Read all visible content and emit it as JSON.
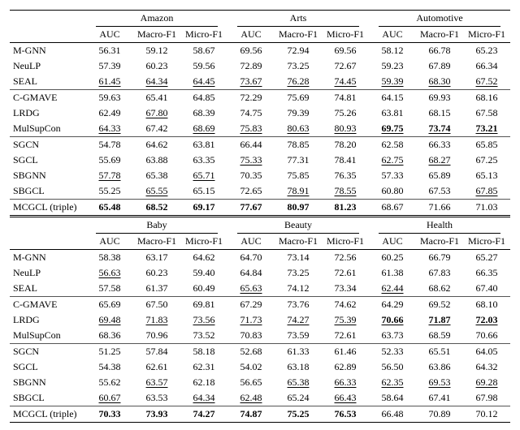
{
  "metrics": [
    "AUC",
    "Macro-F1",
    "Micro-F1"
  ],
  "groups": [
    [
      "M-GNN",
      "NeuLP",
      "SEAL"
    ],
    [
      "C-GMAVE",
      "LRDG",
      "MulSupCon"
    ],
    [
      "SGCN",
      "SGCL",
      "SBGNN",
      "SBGCL"
    ],
    [
      "MCGCL (triple)"
    ]
  ],
  "blocks": [
    {
      "datasets": [
        "Amazon",
        "Arts",
        "Automotive"
      ],
      "rows": {
        "M-GNN": [
          [
            "56.31",
            "p"
          ],
          [
            "59.12",
            "p"
          ],
          [
            "58.67",
            "p"
          ],
          [
            "69.56",
            "p"
          ],
          [
            "72.94",
            "p"
          ],
          [
            "69.56",
            "p"
          ],
          [
            "58.12",
            "p"
          ],
          [
            "66.78",
            "p"
          ],
          [
            "65.23",
            "p"
          ]
        ],
        "NeuLP": [
          [
            "57.39",
            "p"
          ],
          [
            "60.23",
            "p"
          ],
          [
            "59.56",
            "p"
          ],
          [
            "72.89",
            "p"
          ],
          [
            "73.25",
            "p"
          ],
          [
            "72.67",
            "p"
          ],
          [
            "59.23",
            "p"
          ],
          [
            "67.89",
            "p"
          ],
          [
            "66.34",
            "p"
          ]
        ],
        "SEAL": [
          [
            "61.45",
            "u"
          ],
          [
            "64.34",
            "u"
          ],
          [
            "64.45",
            "u"
          ],
          [
            "73.67",
            "u"
          ],
          [
            "76.28",
            "u"
          ],
          [
            "74.45",
            "u"
          ],
          [
            "59.39",
            "u"
          ],
          [
            "68.30",
            "u"
          ],
          [
            "67.52",
            "u"
          ]
        ],
        "C-GMAVE": [
          [
            "59.63",
            "p"
          ],
          [
            "65.41",
            "p"
          ],
          [
            "64.85",
            "p"
          ],
          [
            "72.29",
            "p"
          ],
          [
            "75.69",
            "p"
          ],
          [
            "74.81",
            "p"
          ],
          [
            "64.15",
            "p"
          ],
          [
            "69.93",
            "p"
          ],
          [
            "68.16",
            "p"
          ]
        ],
        "LRDG": [
          [
            "62.49",
            "p"
          ],
          [
            "67.80",
            "u"
          ],
          [
            "68.39",
            "p"
          ],
          [
            "74.75",
            "p"
          ],
          [
            "79.39",
            "p"
          ],
          [
            "75.26",
            "p"
          ],
          [
            "63.81",
            "p"
          ],
          [
            "68.15",
            "p"
          ],
          [
            "67.58",
            "p"
          ]
        ],
        "MulSupCon": [
          [
            "64.33",
            "u"
          ],
          [
            "67.42",
            "p"
          ],
          [
            "68.69",
            "u"
          ],
          [
            "75.83",
            "u"
          ],
          [
            "80.63",
            "u"
          ],
          [
            "80.93",
            "u"
          ],
          [
            "69.75",
            "bu"
          ],
          [
            "73.74",
            "bu"
          ],
          [
            "73.21",
            "bu"
          ]
        ],
        "SGCN": [
          [
            "54.78",
            "p"
          ],
          [
            "64.62",
            "p"
          ],
          [
            "63.81",
            "p"
          ],
          [
            "66.44",
            "p"
          ],
          [
            "78.85",
            "p"
          ],
          [
            "78.20",
            "p"
          ],
          [
            "62.58",
            "p"
          ],
          [
            "66.33",
            "p"
          ],
          [
            "65.85",
            "p"
          ]
        ],
        "SGCL": [
          [
            "55.69",
            "p"
          ],
          [
            "63.88",
            "p"
          ],
          [
            "63.35",
            "p"
          ],
          [
            "75.33",
            "u"
          ],
          [
            "77.31",
            "p"
          ],
          [
            "78.41",
            "p"
          ],
          [
            "62.75",
            "u"
          ],
          [
            "68.27",
            "u"
          ],
          [
            "67.25",
            "p"
          ]
        ],
        "SBGNN": [
          [
            "57.78",
            "u"
          ],
          [
            "65.38",
            "p"
          ],
          [
            "65.71",
            "u"
          ],
          [
            "70.35",
            "p"
          ],
          [
            "75.85",
            "p"
          ],
          [
            "76.35",
            "p"
          ],
          [
            "57.33",
            "p"
          ],
          [
            "65.89",
            "p"
          ],
          [
            "65.13",
            "p"
          ]
        ],
        "SBGCL": [
          [
            "55.25",
            "p"
          ],
          [
            "65.55",
            "u"
          ],
          [
            "65.15",
            "p"
          ],
          [
            "72.65",
            "p"
          ],
          [
            "78.91",
            "u"
          ],
          [
            "78.55",
            "u"
          ],
          [
            "60.80",
            "p"
          ],
          [
            "67.53",
            "p"
          ],
          [
            "67.85",
            "u"
          ]
        ],
        "MCGCL (triple)": [
          [
            "65.48",
            "b"
          ],
          [
            "68.52",
            "b"
          ],
          [
            "69.17",
            "b"
          ],
          [
            "77.67",
            "b"
          ],
          [
            "80.97",
            "b"
          ],
          [
            "81.23",
            "b"
          ],
          [
            "68.67",
            "p"
          ],
          [
            "71.66",
            "p"
          ],
          [
            "71.03",
            "p"
          ]
        ]
      }
    },
    {
      "datasets": [
        "Baby",
        "Beauty",
        "Health"
      ],
      "rows": {
        "M-GNN": [
          [
            "58.38",
            "p"
          ],
          [
            "63.17",
            "p"
          ],
          [
            "64.62",
            "p"
          ],
          [
            "64.70",
            "p"
          ],
          [
            "73.14",
            "p"
          ],
          [
            "72.56",
            "p"
          ],
          [
            "60.25",
            "p"
          ],
          [
            "66.79",
            "p"
          ],
          [
            "65.27",
            "p"
          ]
        ],
        "NeuLP": [
          [
            "56.63",
            "u"
          ],
          [
            "60.23",
            "p"
          ],
          [
            "59.40",
            "p"
          ],
          [
            "64.84",
            "p"
          ],
          [
            "73.25",
            "p"
          ],
          [
            "72.61",
            "p"
          ],
          [
            "61.38",
            "p"
          ],
          [
            "67.83",
            "p"
          ],
          [
            "66.35",
            "p"
          ]
        ],
        "SEAL": [
          [
            "57.58",
            "p"
          ],
          [
            "61.37",
            "p"
          ],
          [
            "60.49",
            "p"
          ],
          [
            "65.63",
            "u"
          ],
          [
            "74.12",
            "p"
          ],
          [
            "73.34",
            "p"
          ],
          [
            "62.44",
            "u"
          ],
          [
            "68.62",
            "p"
          ],
          [
            "67.40",
            "p"
          ]
        ],
        "C-GMAVE": [
          [
            "65.69",
            "p"
          ],
          [
            "67.50",
            "p"
          ],
          [
            "69.81",
            "p"
          ],
          [
            "67.29",
            "p"
          ],
          [
            "73.76",
            "p"
          ],
          [
            "74.62",
            "p"
          ],
          [
            "64.29",
            "p"
          ],
          [
            "69.52",
            "p"
          ],
          [
            "68.10",
            "p"
          ]
        ],
        "LRDG": [
          [
            "69.48",
            "u"
          ],
          [
            "71.83",
            "u"
          ],
          [
            "73.56",
            "u"
          ],
          [
            "71.73",
            "u"
          ],
          [
            "74.27",
            "u"
          ],
          [
            "75.39",
            "u"
          ],
          [
            "70.66",
            "bu"
          ],
          [
            "71.87",
            "bu"
          ],
          [
            "72.03",
            "bu"
          ]
        ],
        "MulSupCon": [
          [
            "68.36",
            "p"
          ],
          [
            "70.96",
            "p"
          ],
          [
            "73.52",
            "p"
          ],
          [
            "70.83",
            "p"
          ],
          [
            "73.59",
            "p"
          ],
          [
            "72.61",
            "p"
          ],
          [
            "63.73",
            "p"
          ],
          [
            "68.59",
            "p"
          ],
          [
            "70.66",
            "p"
          ]
        ],
        "SGCN": [
          [
            "51.25",
            "p"
          ],
          [
            "57.84",
            "p"
          ],
          [
            "58.18",
            "p"
          ],
          [
            "52.68",
            "p"
          ],
          [
            "61.33",
            "p"
          ],
          [
            "61.46",
            "p"
          ],
          [
            "52.33",
            "p"
          ],
          [
            "65.51",
            "p"
          ],
          [
            "64.05",
            "p"
          ]
        ],
        "SGCL": [
          [
            "54.38",
            "p"
          ],
          [
            "62.61",
            "p"
          ],
          [
            "62.31",
            "p"
          ],
          [
            "54.02",
            "p"
          ],
          [
            "63.18",
            "p"
          ],
          [
            "62.89",
            "p"
          ],
          [
            "56.50",
            "p"
          ],
          [
            "63.86",
            "p"
          ],
          [
            "64.32",
            "p"
          ]
        ],
        "SBGNN": [
          [
            "55.62",
            "p"
          ],
          [
            "63.57",
            "u"
          ],
          [
            "62.18",
            "p"
          ],
          [
            "56.65",
            "p"
          ],
          [
            "65.38",
            "u"
          ],
          [
            "66.33",
            "u"
          ],
          [
            "62.35",
            "u"
          ],
          [
            "69.53",
            "u"
          ],
          [
            "69.28",
            "u"
          ]
        ],
        "SBGCL": [
          [
            "60.67",
            "u"
          ],
          [
            "63.53",
            "p"
          ],
          [
            "64.34",
            "u"
          ],
          [
            "62.48",
            "u"
          ],
          [
            "65.24",
            "p"
          ],
          [
            "66.43",
            "u"
          ],
          [
            "58.64",
            "p"
          ],
          [
            "67.41",
            "p"
          ],
          [
            "67.98",
            "p"
          ]
        ],
        "MCGCL (triple)": [
          [
            "70.33",
            "b"
          ],
          [
            "73.93",
            "b"
          ],
          [
            "74.27",
            "b"
          ],
          [
            "74.87",
            "b"
          ],
          [
            "75.25",
            "b"
          ],
          [
            "76.53",
            "b"
          ],
          [
            "66.48",
            "p"
          ],
          [
            "70.89",
            "p"
          ],
          [
            "70.12",
            "p"
          ]
        ]
      }
    }
  ],
  "chart_data": {
    "type": "table",
    "note": "Two stacked result tables; values are percentages for AUC / Macro-F1 / Micro-F1. 'b' = bold (best), 'u' = underlined (runner-up), 'bu' = bold+underlined, 'p' = plain.",
    "blocks": "see blocks above"
  }
}
